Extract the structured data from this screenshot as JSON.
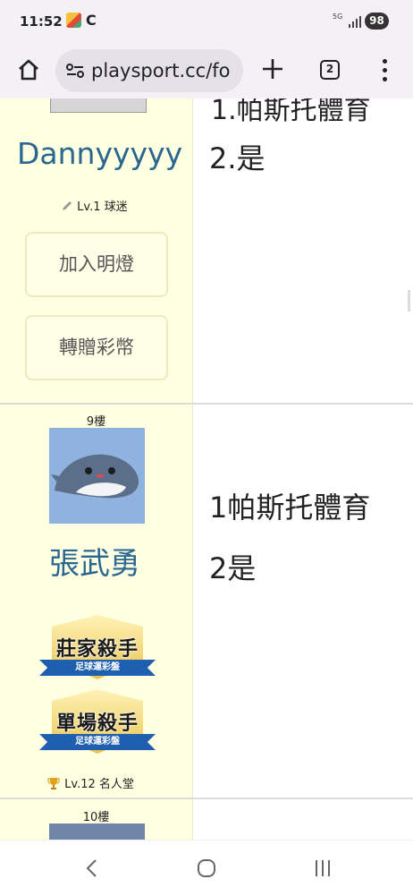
{
  "status_bar": {
    "time": "11:52",
    "app_letter": "C",
    "network": "5G",
    "battery": "98"
  },
  "browser": {
    "url": "playsport.cc/fo",
    "tab_count": "2"
  },
  "thread": {
    "top_post": {
      "partial_line": "1.帕斯托體育",
      "username": "Dannyyyyy",
      "level": "Lv.1 球迷",
      "buttons": [
        "加入明燈",
        "轉贈彩幣"
      ],
      "lines": [
        "2.是"
      ]
    },
    "post_9": {
      "floor": "9樓",
      "username": "張武勇",
      "badges": [
        {
          "title": "莊家殺手",
          "subtitle": "足球運彩盤"
        },
        {
          "title": "單場殺手",
          "subtitle": "足球運彩盤"
        }
      ],
      "level": "Lv.12 名人堂",
      "lines": [
        "1帕斯托體育",
        "2是"
      ]
    },
    "post_10": {
      "floor": "10樓"
    }
  }
}
